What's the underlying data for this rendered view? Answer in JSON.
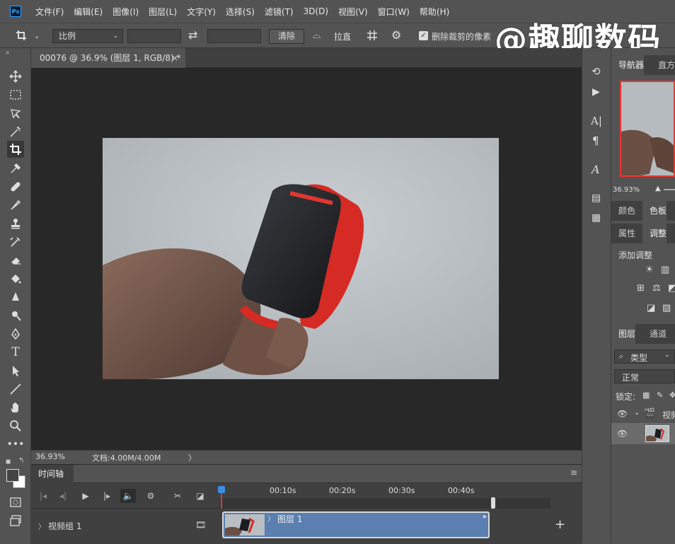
{
  "app": {
    "logo_text": "Ps"
  },
  "menu": [
    "文件(F)",
    "编辑(E)",
    "图像(I)",
    "图层(L)",
    "文字(Y)",
    "选择(S)",
    "滤镜(T)",
    "3D(D)",
    "视图(V)",
    "窗口(W)",
    "帮助(H)"
  ],
  "watermark": "@趣聊数码",
  "options": {
    "ratio_label": "比例",
    "clear_label": "清除",
    "straighten_label": "拉直",
    "delete_cropped_label": "删除裁剪的像素"
  },
  "document": {
    "tab_title": "00076 @ 36.9% (图层 1, RGB/8) *",
    "close_glyph": "×"
  },
  "statusbar": {
    "zoom": "36.93%",
    "doc_info": "文档:4.00M/4.00M",
    "arrow": "〉"
  },
  "timeline": {
    "tab_label": "时间轴",
    "ticks": [
      "00:10s",
      "00:20s",
      "00:30s",
      "00:40s"
    ],
    "track_label": "视频组 1",
    "clip_label": "图层 1",
    "add_glyph": "+"
  },
  "right_panel": {
    "navigator_tab": "导航器",
    "histogram_tab": "直方",
    "nav_zoom": "36.93%",
    "color_tab": "颜色",
    "swatches_tab": "色板",
    "properties_tab": "属性",
    "adjustments_tab": "调整",
    "add_adjustment": "添加调整",
    "layers_tab": "图层",
    "channels_tab": "通道",
    "filter_kind": "类型",
    "blend_mode": "正常",
    "lock_label": "锁定:",
    "group_name": "视频"
  }
}
